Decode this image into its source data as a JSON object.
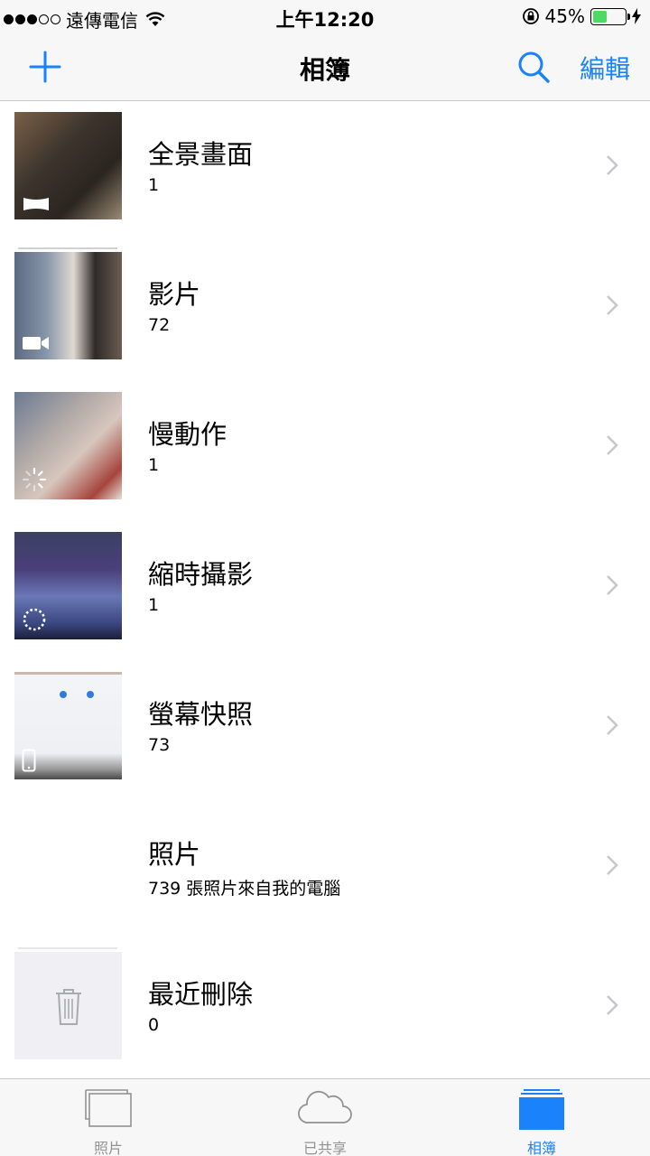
{
  "status_bar": {
    "carrier": "遠傳電信",
    "time": "上午12:20",
    "battery_percent": "45%",
    "battery_level": 0.45,
    "signal_bars_filled": 3,
    "signal_bars_total": 5
  },
  "nav": {
    "title": "相簿",
    "edit_label": "編輯"
  },
  "albums": [
    {
      "name": "全景畫面",
      "count": "1",
      "badge_icon": "panorama-icon"
    },
    {
      "name": "影片",
      "count": "72",
      "badge_icon": "video-camera-icon"
    },
    {
      "name": "慢動作",
      "count": "1",
      "badge_icon": "slow-motion-icon"
    },
    {
      "name": "縮時攝影",
      "count": "1",
      "badge_icon": "time-lapse-icon"
    },
    {
      "name": "螢幕快照",
      "count": "73",
      "badge_icon": "phone-icon"
    },
    {
      "name": "照片",
      "count": "739 張照片來自我的電腦",
      "badge_icon": ""
    },
    {
      "name": "最近刪除",
      "count": "0",
      "badge_icon": "trash-icon"
    }
  ],
  "tab_bar": {
    "tabs": [
      {
        "label": "照片",
        "icon": "photos-icon",
        "active": false
      },
      {
        "label": "已共享",
        "icon": "cloud-icon",
        "active": false
      },
      {
        "label": "相簿",
        "icon": "albums-icon",
        "active": true
      }
    ]
  },
  "colors": {
    "accent": "#1a82fb",
    "inactive_tab": "#929292",
    "battery_fill": "#4cd964"
  }
}
